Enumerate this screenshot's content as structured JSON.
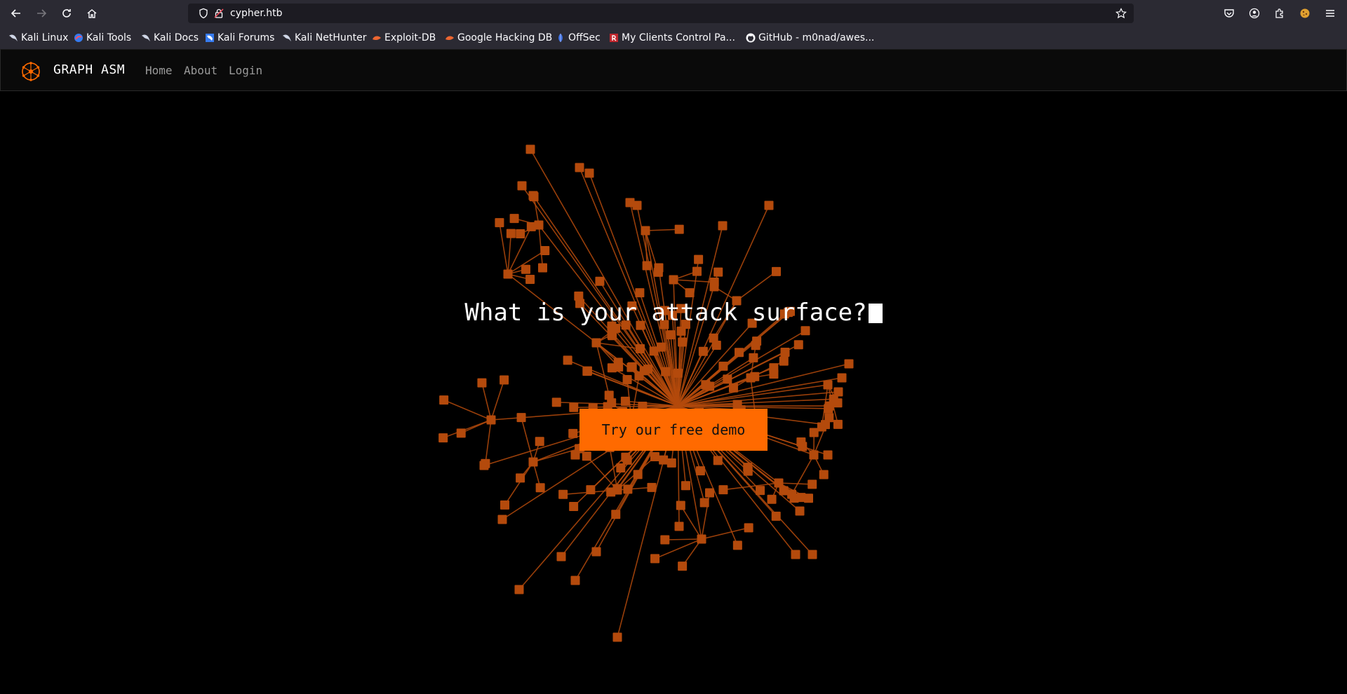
{
  "browser": {
    "url": "cypher.htb",
    "bookmarks": [
      {
        "label": "Kali Linux",
        "icon": "kali-dragon-icon"
      },
      {
        "label": "Kali Tools",
        "icon": "kali-tools-icon"
      },
      {
        "label": "Kali Docs",
        "icon": "kali-dragon-icon"
      },
      {
        "label": "Kali Forums",
        "icon": "kali-forums-icon"
      },
      {
        "label": "Kali NetHunter",
        "icon": "kali-dragon-icon"
      },
      {
        "label": "Exploit-DB",
        "icon": "exploit-db-icon"
      },
      {
        "label": "Google Hacking DB",
        "icon": "exploit-db-icon"
      },
      {
        "label": "OffSec",
        "icon": "offsec-icon"
      },
      {
        "label": "My Clients Control Pa...",
        "icon": "clients-panel-icon"
      },
      {
        "label": "GitHub - m0nad/awes...",
        "icon": "github-icon"
      }
    ]
  },
  "site": {
    "brand": "GRAPH ASM",
    "nav": {
      "home": "Home",
      "about": "About",
      "login": "Login"
    },
    "headline": "What is your attack surface?",
    "cta": "Try our free demo",
    "accent": "#ff6a00",
    "graph_color": "#b44a0c"
  }
}
